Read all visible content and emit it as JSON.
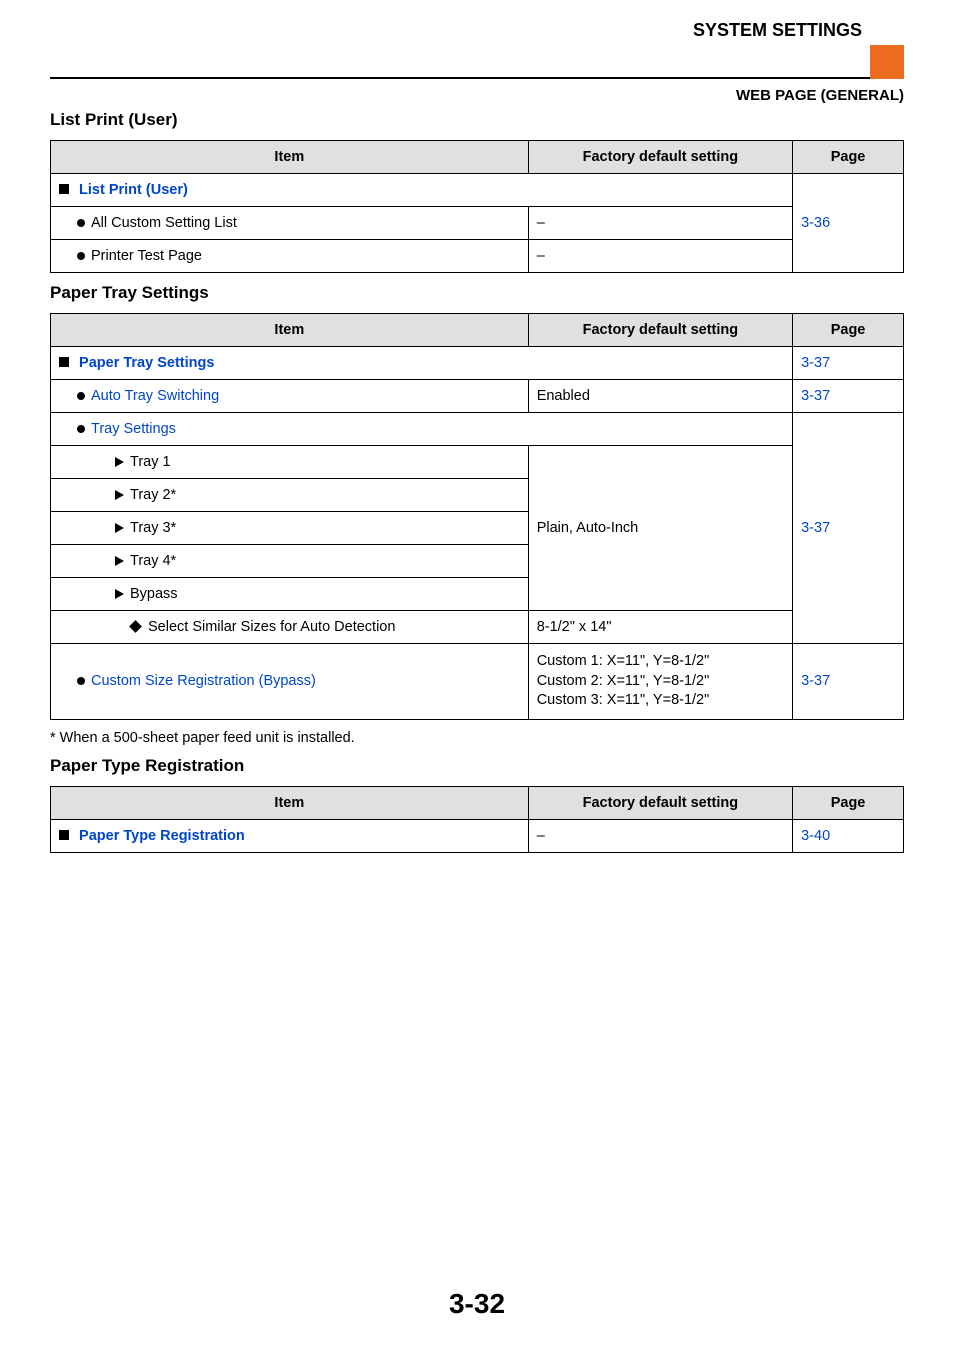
{
  "header": {
    "system_settings": "SYSTEM SETTINGS",
    "sub": "WEB PAGE (GENERAL)"
  },
  "sections": {
    "list_print": {
      "title": "List Print (User)",
      "th_item": "Item",
      "th_factory": "Factory default setting",
      "th_page": "Page",
      "link_label": "List Print (User)",
      "row1_item": "All Custom Setting List",
      "row1_fact": "–",
      "row2_item": "Printer Test Page",
      "row2_fact": "–",
      "page": "3-36"
    },
    "paper_tray": {
      "title": "Paper Tray Settings",
      "th_item": "Item",
      "th_factory": "Factory default setting",
      "th_page": "Page",
      "link_label": "Paper Tray Settings",
      "page1": "3-37",
      "auto_tray_label": "Auto Tray Switching",
      "auto_tray_fact": "Enabled",
      "page2": "3-37",
      "tray_settings_label": "Tray Settings",
      "tray1": "Tray 1",
      "tray2": "Tray 2*",
      "tray3": "Tray 3*",
      "tray4": "Tray 4*",
      "bypass": "Bypass",
      "trays_fact": "Plain, Auto-Inch",
      "page3": "3-37",
      "select_similar": "Select Similar Sizes for Auto Detection",
      "select_similar_fact": "8-1/2\" x 14\"",
      "custom_size_label": "Custom Size Registration (Bypass)",
      "custom_size_fact1": "Custom 1: X=11\", Y=8-1/2\"",
      "custom_size_fact2": "Custom 2: X=11\", Y=8-1/2\"",
      "custom_size_fact3": "Custom 3: X=11\", Y=8-1/2\"",
      "page4": "3-37",
      "footnote": "*  When a 500-sheet paper feed unit is installed."
    },
    "paper_type": {
      "title": "Paper Type Registration",
      "th_item": "Item",
      "th_factory": "Factory default setting",
      "th_page": "Page",
      "link_label": "Paper Type Registration",
      "fact": "–",
      "page": "3-40"
    }
  },
  "page_number": "3-32"
}
